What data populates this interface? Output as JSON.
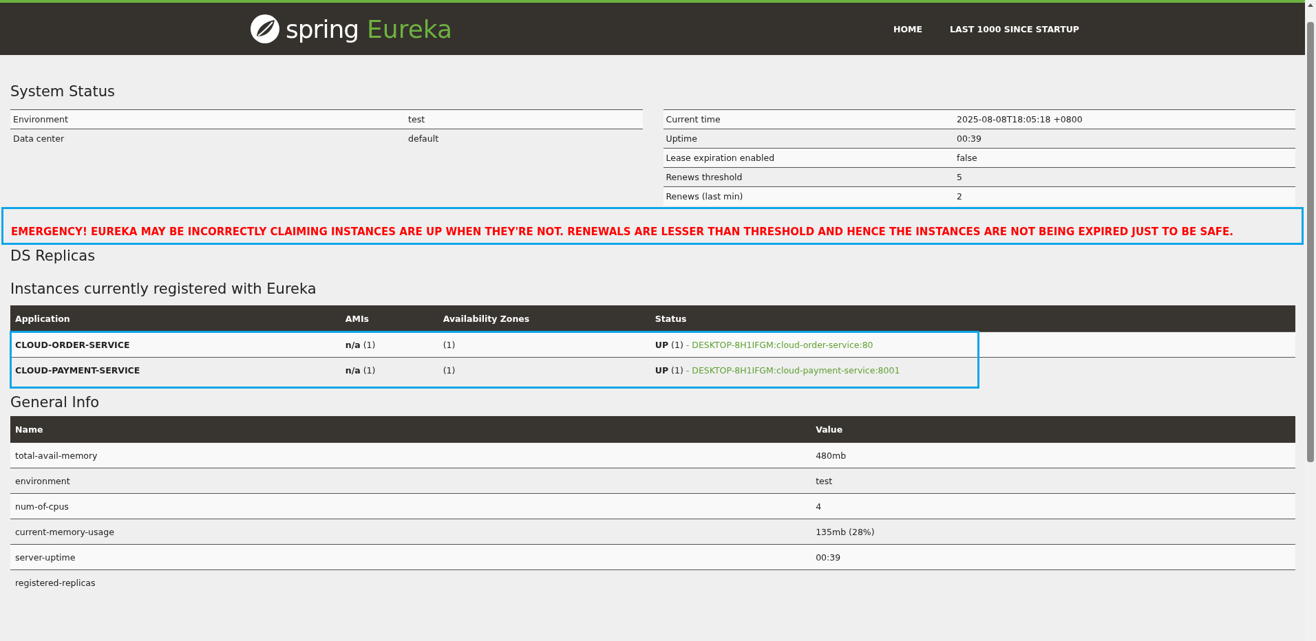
{
  "header": {
    "logo": {
      "brand": "spring",
      "product": "Eureka"
    },
    "nav": [
      {
        "label": "HOME"
      },
      {
        "label": "LAST 1000 SINCE STARTUP"
      }
    ]
  },
  "system_status": {
    "title": "System Status",
    "left_rows": [
      {
        "label": "Environment",
        "value": "test"
      },
      {
        "label": "Data center",
        "value": "default"
      }
    ],
    "right_rows": [
      {
        "label": "Current time",
        "value": "2025-08-08T18:05:18 +0800"
      },
      {
        "label": "Uptime",
        "value": "00:39"
      },
      {
        "label": "Lease expiration enabled",
        "value": "false"
      },
      {
        "label": "Renews threshold",
        "value": "5"
      },
      {
        "label": "Renews (last min)",
        "value": "2"
      }
    ]
  },
  "alert": {
    "text": "EMERGENCY! EUREKA MAY BE INCORRECTLY CLAIMING INSTANCES ARE UP WHEN THEY'RE NOT. RENEWALS ARE LESSER THAN THRESHOLD AND HENCE THE INSTANCES ARE NOT BEING EXPIRED JUST TO BE SAFE.",
    "highlighted": true
  },
  "ds_replicas": {
    "title": "DS Replicas"
  },
  "instances": {
    "title": "Instances currently registered with Eureka",
    "highlighted": true,
    "columns": [
      "Application",
      "AMIs",
      "Availability Zones",
      "Status"
    ],
    "rows": [
      {
        "application": "CLOUD-ORDER-SERVICE",
        "amis": {
          "label": "n/a",
          "count": "(1)"
        },
        "zones": "(1)",
        "status": {
          "label": "UP",
          "count": "(1)",
          "separator": "-",
          "link": "DESKTOP-8H1IFGM:cloud-order-service:80"
        }
      },
      {
        "application": "CLOUD-PAYMENT-SERVICE",
        "amis": {
          "label": "n/a",
          "count": "(1)"
        },
        "zones": "(1)",
        "status": {
          "label": "UP",
          "count": "(1)",
          "separator": "-",
          "link": "DESKTOP-8H1IFGM:cloud-payment-service:8001"
        }
      }
    ]
  },
  "general_info": {
    "title": "General Info",
    "columns": [
      "Name",
      "Value"
    ],
    "rows": [
      {
        "name": "total-avail-memory",
        "value": "480mb"
      },
      {
        "name": "environment",
        "value": "test"
      },
      {
        "name": "num-of-cpus",
        "value": "4"
      },
      {
        "name": "current-memory-usage",
        "value": "135mb (28%)"
      },
      {
        "name": "server-uptime",
        "value": "00:39"
      },
      {
        "name": "registered-replicas",
        "value": ""
      }
    ]
  }
}
